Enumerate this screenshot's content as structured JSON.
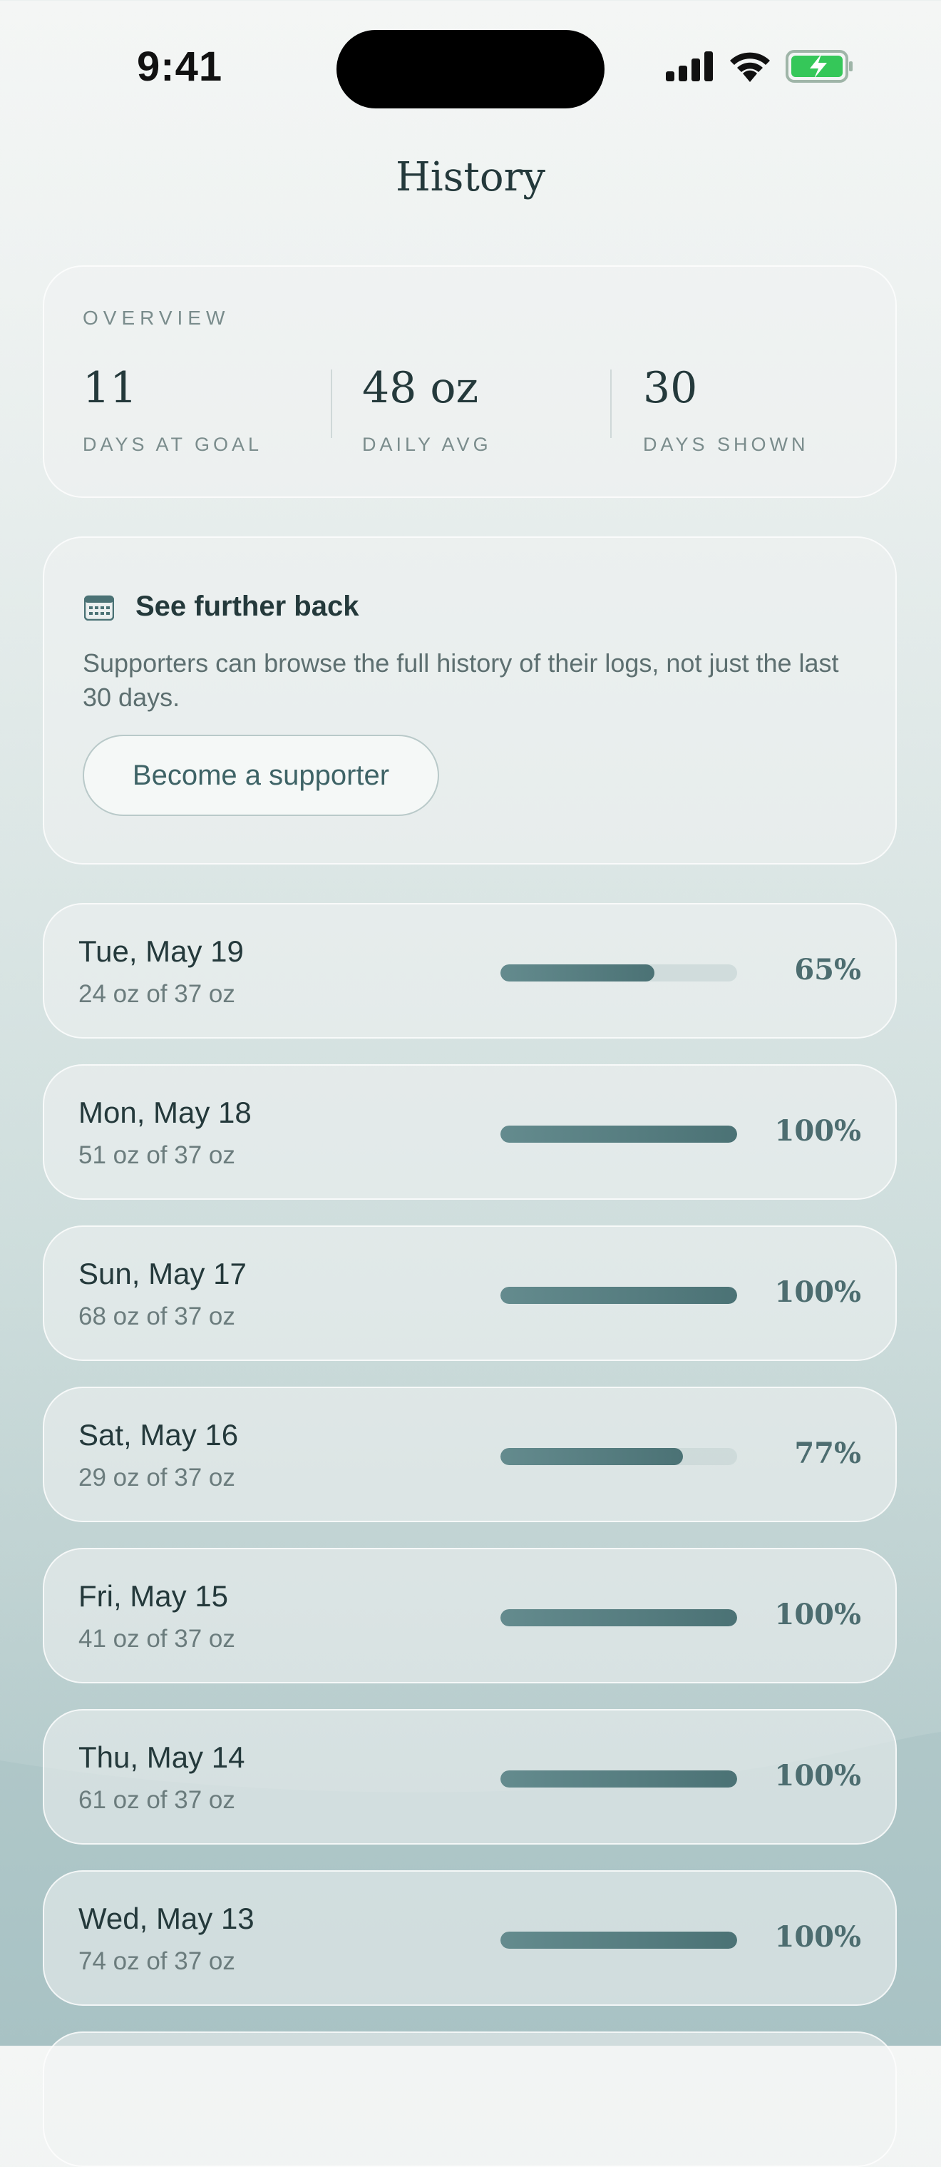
{
  "status_bar": {
    "time": "9:41"
  },
  "header": {
    "title": "History"
  },
  "overview": {
    "label": "OVERVIEW",
    "stats": [
      {
        "value": "11",
        "label": "DAYS AT GOAL"
      },
      {
        "value": "48 oz",
        "label": "DAILY AVG"
      },
      {
        "value": "30",
        "label": "DAYS SHOWN"
      }
    ]
  },
  "promo": {
    "icon": "calendar-icon",
    "title": "See further back",
    "body": "Supporters can browse the full history of their logs, not just the last 30 days.",
    "button": "Become a supporter"
  },
  "days": [
    {
      "date": "Tue, May 19",
      "detail": "24 oz of 37 oz",
      "percent": "65%",
      "progress": 0.65
    },
    {
      "date": "Mon, May 18",
      "detail": "51 oz of 37 oz",
      "percent": "100%",
      "progress": 1.0
    },
    {
      "date": "Sun, May 17",
      "detail": "68 oz of 37 oz",
      "percent": "100%",
      "progress": 1.0
    },
    {
      "date": "Sat, May 16",
      "detail": "29 oz of 37 oz",
      "percent": "77%",
      "progress": 0.77
    },
    {
      "date": "Fri, May 15",
      "detail": "41 oz of 37 oz",
      "percent": "100%",
      "progress": 1.0
    },
    {
      "date": "Thu, May 14",
      "detail": "61 oz of 37 oz",
      "percent": "100%",
      "progress": 1.0
    },
    {
      "date": "Wed, May 13",
      "detail": "74 oz of 37 oz",
      "percent": "100%",
      "progress": 1.0
    }
  ],
  "colors": {
    "accent": "#4b7275",
    "text": "#24393b",
    "muted": "#7a8c8c"
  }
}
